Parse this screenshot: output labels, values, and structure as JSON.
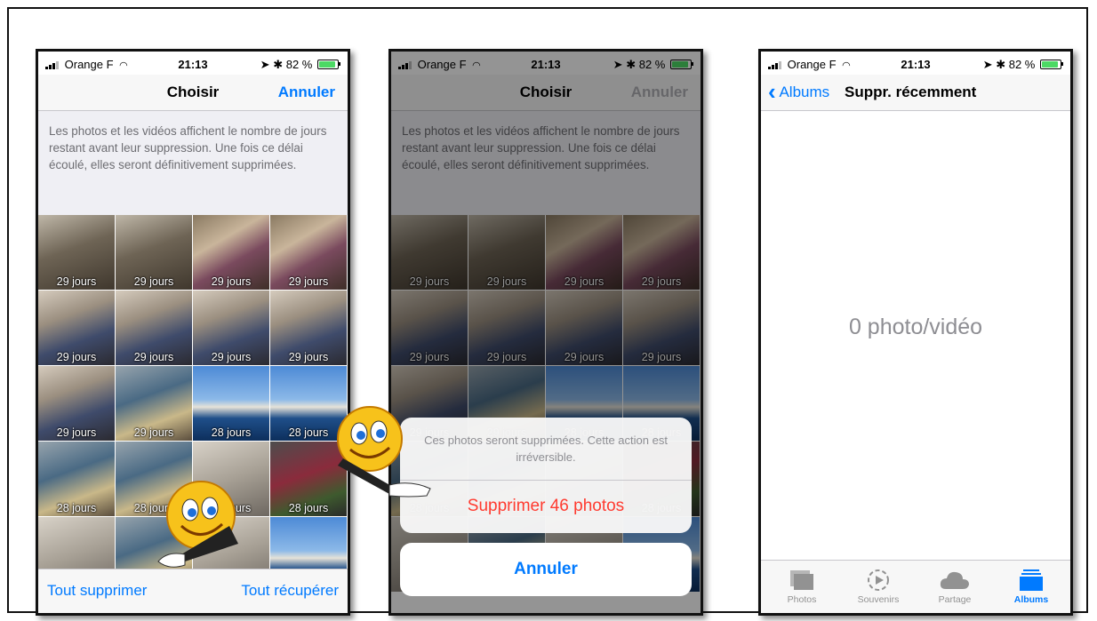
{
  "status": {
    "carrier": "Orange F",
    "time": "21:13",
    "battery": "82 %"
  },
  "screen1": {
    "title": "Choisir",
    "cancel": "Annuler",
    "info": "Les photos et les vidéos affichent le nombre de jours restant avant leur suppression. Une fois ce délai écoulé, elles seront définitivement supprimées.",
    "thumbs": [
      {
        "days": "29 jours",
        "kind": "kitchen"
      },
      {
        "days": "29 jours",
        "kind": "kitchen"
      },
      {
        "days": "29 jours",
        "kind": "party"
      },
      {
        "days": "29 jours",
        "kind": "party"
      },
      {
        "days": "29 jours",
        "kind": "man"
      },
      {
        "days": "29 jours",
        "kind": "man"
      },
      {
        "days": "29 jours",
        "kind": "man"
      },
      {
        "days": "29 jours",
        "kind": "man"
      },
      {
        "days": "29 jours",
        "kind": "man"
      },
      {
        "days": "29 jours",
        "kind": "office"
      },
      {
        "days": "28 jours",
        "kind": "boat"
      },
      {
        "days": "28 jours",
        "kind": "boat"
      },
      {
        "days": "28 jours",
        "kind": "office"
      },
      {
        "days": "28 jours",
        "kind": "office"
      },
      {
        "days": "28 jours",
        "kind": "misc"
      },
      {
        "days": "28 jours",
        "kind": "flower"
      },
      {
        "days": "",
        "kind": "misc"
      },
      {
        "days": "",
        "kind": "office"
      },
      {
        "days": "",
        "kind": "misc"
      },
      {
        "days": "",
        "kind": "boat"
      }
    ],
    "delete_all": "Tout supprimer",
    "recover_all": "Tout récupérer"
  },
  "screen2": {
    "title": "Choisir",
    "cancel": "Annuler",
    "info": "Les photos et les vidéos affichent le nombre de jours restant avant leur suppression. Une fois ce délai écoulé, elles seront définitivement supprimées.",
    "sheet_message": "Ces photos seront supprimées. Cette action est irréversible.",
    "sheet_action": "Supprimer 46 photos",
    "sheet_cancel": "Annuler"
  },
  "screen3": {
    "back": "Albums",
    "title": "Suppr. récemment",
    "empty": "0 photo/vidéo",
    "tabs": [
      {
        "label": "Photos",
        "icon": "photos-icon",
        "active": false
      },
      {
        "label": "Souvenirs",
        "icon": "memories-icon",
        "active": false
      },
      {
        "label": "Partage",
        "icon": "cloud-icon",
        "active": false
      },
      {
        "label": "Albums",
        "icon": "albums-icon",
        "active": true
      }
    ]
  },
  "colors": {
    "ios_blue": "#007aff",
    "destructive": "#ff3b30",
    "battery_green": "#4cd964"
  }
}
